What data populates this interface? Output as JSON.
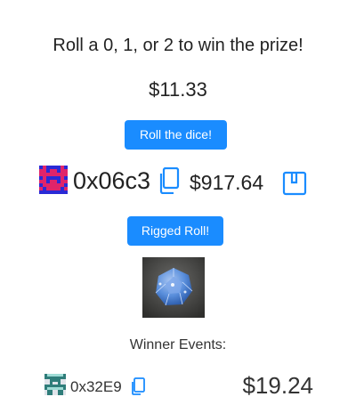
{
  "headline": "Roll a 0, 1, or 2 to win the prize!",
  "prize_amount": "$11.33",
  "roll_button_label": "Roll the dice!",
  "player": {
    "address": "0x06c3",
    "balance": "$917.64",
    "avatar_icon": "pixel-avatar-icon",
    "copy_icon": "copy-icon",
    "save_icon": "bookmark-icon"
  },
  "rigged_button_label": "Rigged Roll!",
  "dice_image_icon": "d12-dice-photo",
  "winner_events": {
    "title": "Winner Events:",
    "items": [
      {
        "address": "0x32E9",
        "amount": "$19.24"
      }
    ]
  },
  "colors": {
    "accent": "#1a8cff"
  }
}
